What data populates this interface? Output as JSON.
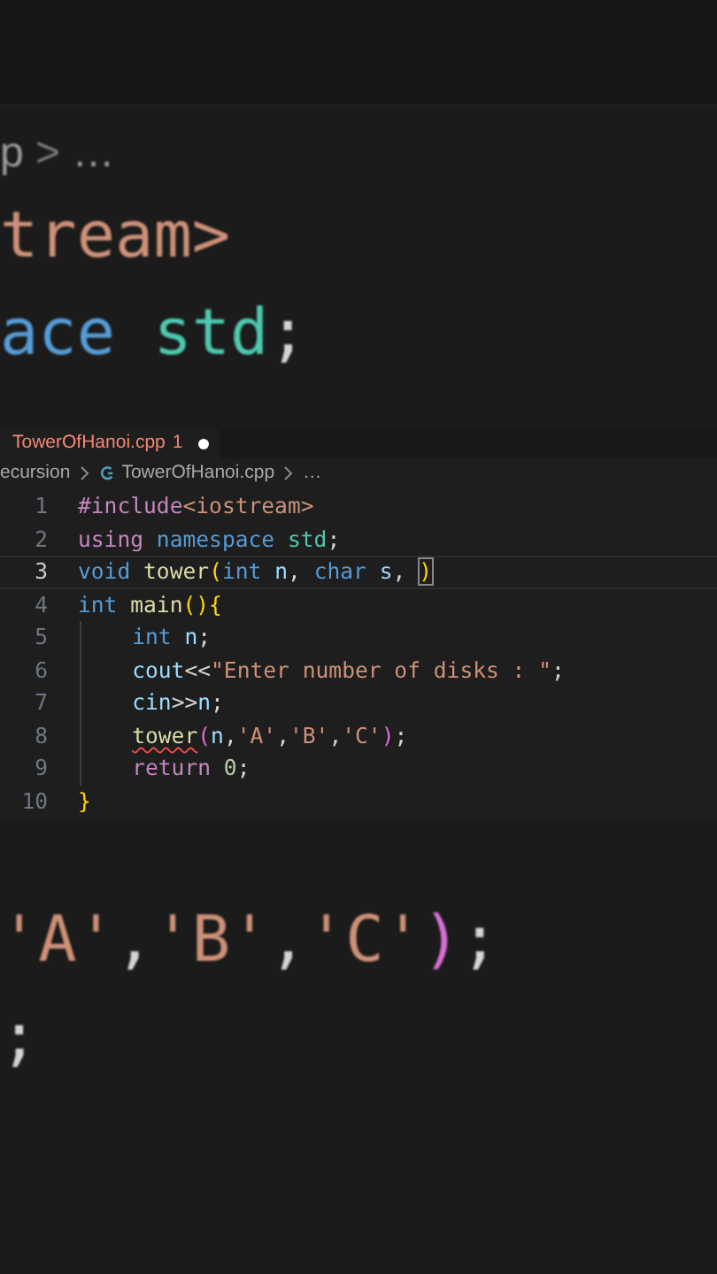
{
  "backdrop_top": [
    [
      {
        "text": "p",
        "kind": "crumb"
      },
      {
        "text": " > ",
        "kind": "sep"
      },
      {
        "text": "…",
        "kind": "crumb"
      }
    ],
    [
      {
        "text": "tream>",
        "kind": "str"
      }
    ],
    [
      {
        "text": "ace ",
        "kind": "kw"
      },
      {
        "text": "std",
        "kind": "type"
      },
      {
        "text": ";",
        "kind": "plain"
      }
    ]
  ],
  "tab": {
    "label": "TowerOfHanoi.cpp",
    "problems": "1",
    "modified": true
  },
  "breadcrumbs": [
    {
      "text": "ecursion",
      "kind": "folder"
    },
    {
      "text": "TowerOfHanoi.cpp",
      "kind": "file"
    },
    {
      "text": "…",
      "kind": "more"
    }
  ],
  "code": [
    {
      "number": "1",
      "active": false,
      "indented": false,
      "tokens": [
        {
          "text": "#include",
          "kind": "ctrl"
        },
        {
          "text": "<iostream>",
          "kind": "str"
        }
      ]
    },
    {
      "number": "2",
      "active": false,
      "indented": false,
      "tokens": [
        {
          "text": "using ",
          "kind": "ctrl"
        },
        {
          "text": "namespace ",
          "kind": "kw"
        },
        {
          "text": "std",
          "kind": "type"
        },
        {
          "text": ";",
          "kind": "plain"
        }
      ]
    },
    {
      "number": "3",
      "active": true,
      "indented": false,
      "tokens": [
        {
          "text": "void ",
          "kind": "kw"
        },
        {
          "text": "tower",
          "kind": "fn"
        },
        {
          "text": "(",
          "kind": "bracket1"
        },
        {
          "text": "int ",
          "kind": "kw"
        },
        {
          "text": "n",
          "kind": "var"
        },
        {
          "text": ", ",
          "kind": "plain"
        },
        {
          "text": "char ",
          "kind": "kw"
        },
        {
          "text": "s",
          "kind": "var"
        },
        {
          "text": ", ",
          "kind": "plain"
        },
        {
          "text": ")",
          "kind": "bracket1",
          "matched": true
        }
      ]
    },
    {
      "number": "4",
      "active": false,
      "indented": false,
      "tokens": [
        {
          "text": "int ",
          "kind": "kw"
        },
        {
          "text": "main",
          "kind": "fn"
        },
        {
          "text": "(){",
          "kind": "bracket1"
        }
      ]
    },
    {
      "number": "5",
      "active": false,
      "indented": true,
      "tokens": [
        {
          "text": "int ",
          "kind": "kw"
        },
        {
          "text": "n",
          "kind": "var"
        },
        {
          "text": ";",
          "kind": "plain"
        }
      ]
    },
    {
      "number": "6",
      "active": false,
      "indented": true,
      "tokens": [
        {
          "text": "cout",
          "kind": "var"
        },
        {
          "text": "<<",
          "kind": "plain"
        },
        {
          "text": "\"Enter number of disks : \"",
          "kind": "str"
        },
        {
          "text": ";",
          "kind": "plain"
        }
      ]
    },
    {
      "number": "7",
      "active": false,
      "indented": true,
      "tokens": [
        {
          "text": "cin",
          "kind": "var"
        },
        {
          "text": ">>",
          "kind": "plain"
        },
        {
          "text": "n",
          "kind": "var"
        },
        {
          "text": ";",
          "kind": "plain"
        }
      ]
    },
    {
      "number": "8",
      "active": false,
      "indented": true,
      "tokens": [
        {
          "text": "tower",
          "kind": "fn",
          "error": true
        },
        {
          "text": "(",
          "kind": "bracket2"
        },
        {
          "text": "n",
          "kind": "var"
        },
        {
          "text": ",",
          "kind": "plain"
        },
        {
          "text": "'A'",
          "kind": "str"
        },
        {
          "text": ",",
          "kind": "plain"
        },
        {
          "text": "'B'",
          "kind": "str"
        },
        {
          "text": ",",
          "kind": "plain"
        },
        {
          "text": "'C'",
          "kind": "str"
        },
        {
          "text": ")",
          "kind": "bracket2"
        },
        {
          "text": ";",
          "kind": "plain"
        }
      ]
    },
    {
      "number": "9",
      "active": false,
      "indented": true,
      "tokens": [
        {
          "text": "return ",
          "kind": "ctrl"
        },
        {
          "text": "0",
          "kind": "num"
        },
        {
          "text": ";",
          "kind": "plain"
        }
      ]
    },
    {
      "number": "10",
      "active": false,
      "indented": false,
      "tokens": [
        {
          "text": "}",
          "kind": "bracket1"
        }
      ]
    }
  ],
  "backdrop_bottom": [
    [
      {
        "text": "'A'",
        "kind": "str"
      },
      {
        "text": ",",
        "kind": "plain"
      },
      {
        "text": "'B'",
        "kind": "str"
      },
      {
        "text": ",",
        "kind": "plain"
      },
      {
        "text": "'C'",
        "kind": "str"
      },
      {
        "text": ")",
        "kind": "bracket2"
      },
      {
        "text": ";",
        "kind": "plain"
      }
    ],
    [
      {
        "text": ";",
        "kind": "plain"
      }
    ]
  ]
}
